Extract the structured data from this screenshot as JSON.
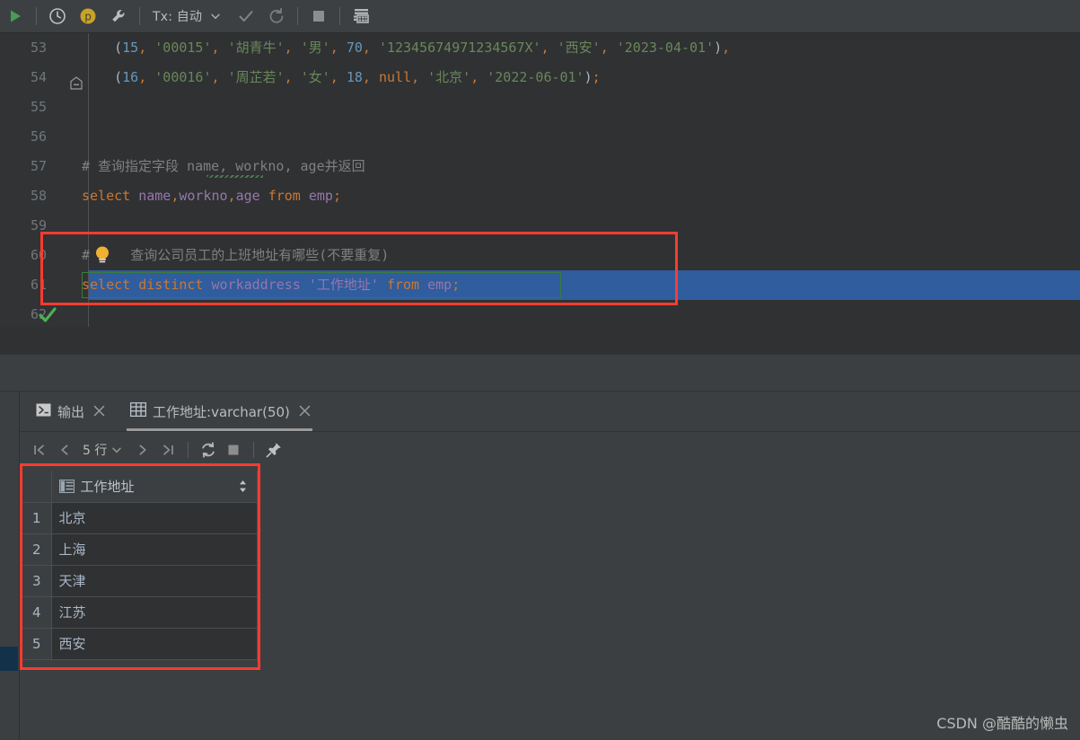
{
  "toolbar": {
    "run_label": "run-icon",
    "history_label": "history-icon",
    "profile_label": "p",
    "tools_label": "wrench-icon",
    "tx_label": "Tx: 自动",
    "commit_label": "commit-icon",
    "rollback_label": "rollback-icon",
    "stop_label": "stop-icon",
    "grid_label": "data-grid-icon"
  },
  "editor": {
    "lines": [
      {
        "num": "53",
        "tokens": [
          {
            "t": "    ",
            "c": "plain"
          },
          {
            "t": "(",
            "c": "pun"
          },
          {
            "t": "15",
            "c": "num"
          },
          {
            "t": ", ",
            "c": "comma"
          },
          {
            "t": "'00015'",
            "c": "str"
          },
          {
            "t": ", ",
            "c": "comma"
          },
          {
            "t": "'胡青牛'",
            "c": "str"
          },
          {
            "t": ", ",
            "c": "comma"
          },
          {
            "t": "'男'",
            "c": "str"
          },
          {
            "t": ", ",
            "c": "comma"
          },
          {
            "t": "70",
            "c": "num"
          },
          {
            "t": ", ",
            "c": "comma"
          },
          {
            "t": "'12345674971234567X'",
            "c": "str"
          },
          {
            "t": ", ",
            "c": "comma"
          },
          {
            "t": "'西安'",
            "c": "str"
          },
          {
            "t": ", ",
            "c": "comma"
          },
          {
            "t": "'2023-04-01'",
            "c": "str"
          },
          {
            "t": ")",
            "c": "pun"
          },
          {
            "t": ",",
            "c": "comma"
          }
        ]
      },
      {
        "num": "54",
        "fold": true,
        "tokens": [
          {
            "t": "    ",
            "c": "plain"
          },
          {
            "t": "(",
            "c": "pun"
          },
          {
            "t": "16",
            "c": "num"
          },
          {
            "t": ", ",
            "c": "comma"
          },
          {
            "t": "'00016'",
            "c": "str"
          },
          {
            "t": ", ",
            "c": "comma"
          },
          {
            "t": "'周芷若'",
            "c": "str"
          },
          {
            "t": ", ",
            "c": "comma"
          },
          {
            "t": "'女'",
            "c": "str"
          },
          {
            "t": ", ",
            "c": "comma"
          },
          {
            "t": "18",
            "c": "num"
          },
          {
            "t": ", ",
            "c": "comma"
          },
          {
            "t": "null",
            "c": "kw"
          },
          {
            "t": ", ",
            "c": "comma"
          },
          {
            "t": "'北京'",
            "c": "str"
          },
          {
            "t": ", ",
            "c": "comma"
          },
          {
            "t": "'2022-06-01'",
            "c": "str"
          },
          {
            "t": ")",
            "c": "pun"
          },
          {
            "t": ";",
            "c": "comma"
          }
        ]
      },
      {
        "num": "55",
        "tokens": []
      },
      {
        "num": "56",
        "tokens": []
      },
      {
        "num": "57",
        "tokens": [
          {
            "t": "# 查询指定字段 name, workno, age并返回",
            "c": "cmt"
          }
        ]
      },
      {
        "num": "58",
        "tokens": [
          {
            "t": "select",
            "c": "kw"
          },
          {
            "t": " ",
            "c": "plain"
          },
          {
            "t": "name",
            "c": "fld"
          },
          {
            "t": ",",
            "c": "comma"
          },
          {
            "t": "workno",
            "c": "fld"
          },
          {
            "t": ",",
            "c": "comma"
          },
          {
            "t": "age",
            "c": "fld"
          },
          {
            "t": " ",
            "c": "plain"
          },
          {
            "t": "from",
            "c": "kw"
          },
          {
            "t": " ",
            "c": "plain"
          },
          {
            "t": "emp",
            "c": "fld"
          },
          {
            "t": ";",
            "c": "comma"
          }
        ]
      },
      {
        "num": "59",
        "tokens": []
      },
      {
        "num": "60",
        "bulb": true,
        "tokens": [
          {
            "t": "#",
            "c": "cmt"
          },
          {
            "t": "     ",
            "c": "plain"
          },
          {
            "t": "查询公司员工的上班地址有哪些(不要重复)",
            "c": "cmt"
          }
        ]
      },
      {
        "num": "61",
        "selected": true,
        "check": true,
        "tokens": [
          {
            "t": "select",
            "c": "kw"
          },
          {
            "t": " ",
            "c": "plain"
          },
          {
            "t": "distinct",
            "c": "kw"
          },
          {
            "t": " ",
            "c": "plain"
          },
          {
            "t": "workaddress",
            "c": "fld"
          },
          {
            "t": " ",
            "c": "plain"
          },
          {
            "t": "'工作地址'",
            "c": "fld"
          },
          {
            "t": " ",
            "c": "plain"
          },
          {
            "t": "from",
            "c": "kw"
          },
          {
            "t": " ",
            "c": "plain"
          },
          {
            "t": "emp",
            "c": "fld"
          },
          {
            "t": ";",
            "c": "comma"
          }
        ]
      },
      {
        "num": "62",
        "tokens": []
      }
    ]
  },
  "results": {
    "tabs": [
      {
        "label": "输出",
        "icon": "console-output-icon",
        "active": false
      },
      {
        "label": "工作地址:varchar(50)",
        "icon": "table-icon",
        "active": true
      }
    ],
    "nav": {
      "first_label": "first-page-icon",
      "prev_label": "prev-page-icon",
      "row_count": "5 行",
      "dropdown_label": "chevron-down-icon",
      "next_label": "next-page-icon",
      "last_label": "last-page-icon",
      "refresh_label": "refresh-icon",
      "stop_label": "stop-icon",
      "pin_label": "pin-icon"
    },
    "grid": {
      "column_icon": "column-type-icon",
      "column_header": "工作地址",
      "sort_label": "sort-arrows-icon",
      "rows": [
        {
          "n": "1",
          "value": "北京"
        },
        {
          "n": "2",
          "value": "上海"
        },
        {
          "n": "3",
          "value": "天津"
        },
        {
          "n": "4",
          "value": "江苏"
        },
        {
          "n": "5",
          "value": "西安"
        }
      ]
    }
  },
  "watermark": {
    "text": "CSDN @酷酷的懒虫"
  },
  "colors": {
    "accent_red": "#ff3b30",
    "selection_blue": "#2f5d9e",
    "keyword_orange": "#cc7832",
    "string_green": "#6a8759",
    "number_blue": "#6897bb",
    "field_purple": "#9876aa",
    "comment_gray": "#808080",
    "run_green": "#499c54"
  }
}
